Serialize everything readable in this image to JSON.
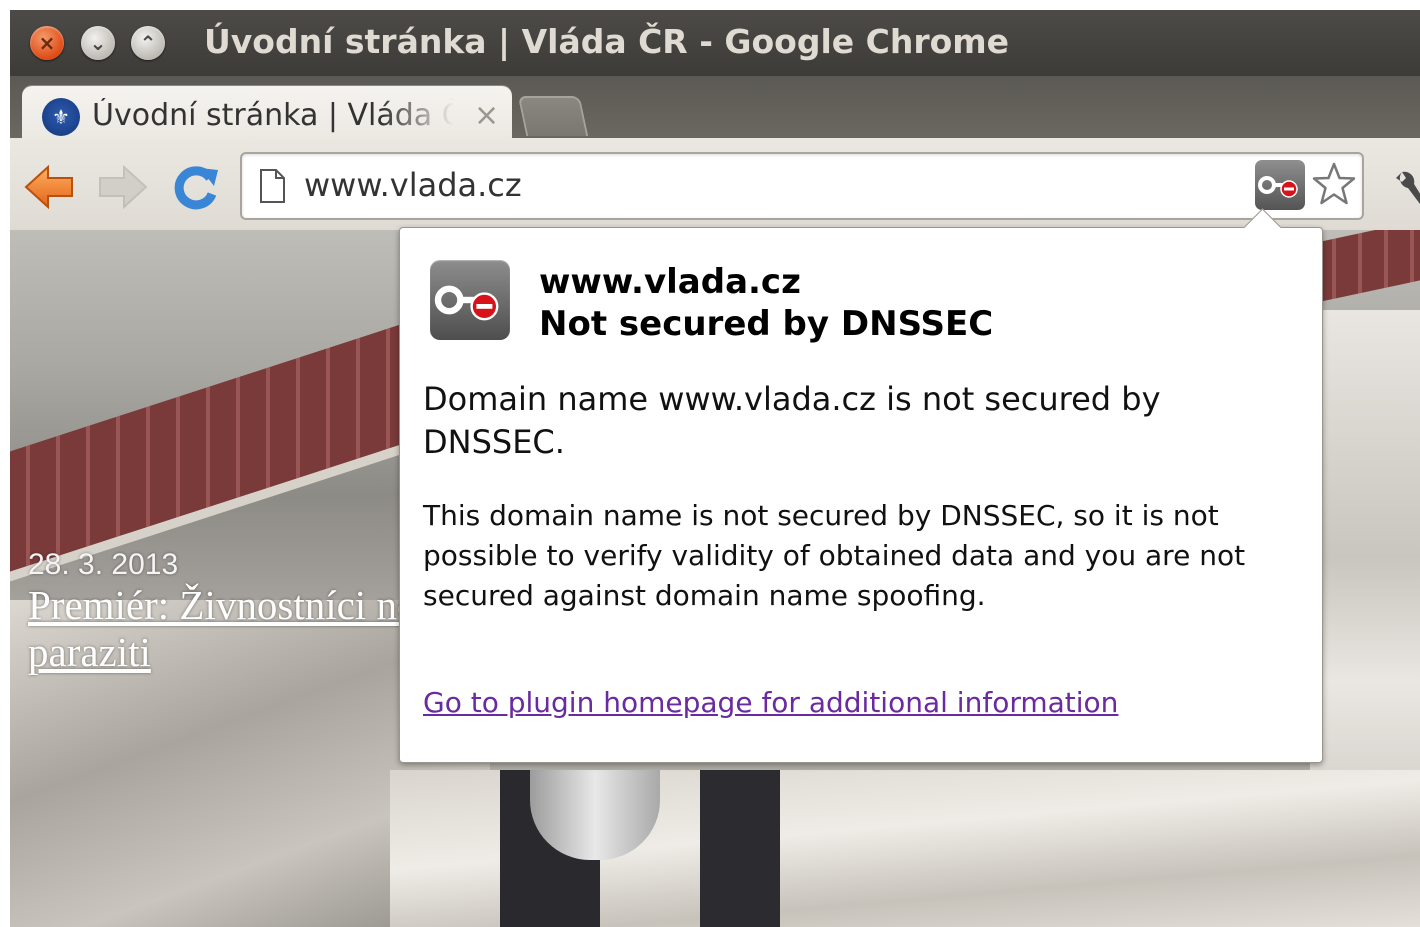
{
  "window": {
    "title": "Úvodní stránka | Vláda ČR - Google Chrome"
  },
  "tab": {
    "title": "Úvodní stránka | Vláda ČR",
    "close_glyph": "×"
  },
  "toolbar": {
    "url": "www.vlada.cz"
  },
  "page": {
    "news_date": "28. 3. 2013",
    "news_headline": "Premiér: Živnostníci nejsou paraziti"
  },
  "dnssec_popup": {
    "domain": "www.vlada.cz",
    "status": "Not secured by DNSSEC",
    "summary": "Domain name www.vlada.cz is not secured by DNSSEC.",
    "detail": "This domain name is not secured by DNSSEC, so it is not possible to verify validity of obtained data and you are not secured against domain name spoofing.",
    "link": "Go to plugin homepage for additional information"
  },
  "colors": {
    "link": "#6a2aa0",
    "close_button": "#df4a16",
    "titlebar": "#3c3b37"
  },
  "icons": [
    "close-icon",
    "minimize-icon",
    "maximize-icon",
    "government-favicon-icon",
    "back-arrow-icon",
    "forward-arrow-icon",
    "reload-icon",
    "page-icon",
    "dnssec-key-icon",
    "star-icon",
    "wrench-icon"
  ]
}
